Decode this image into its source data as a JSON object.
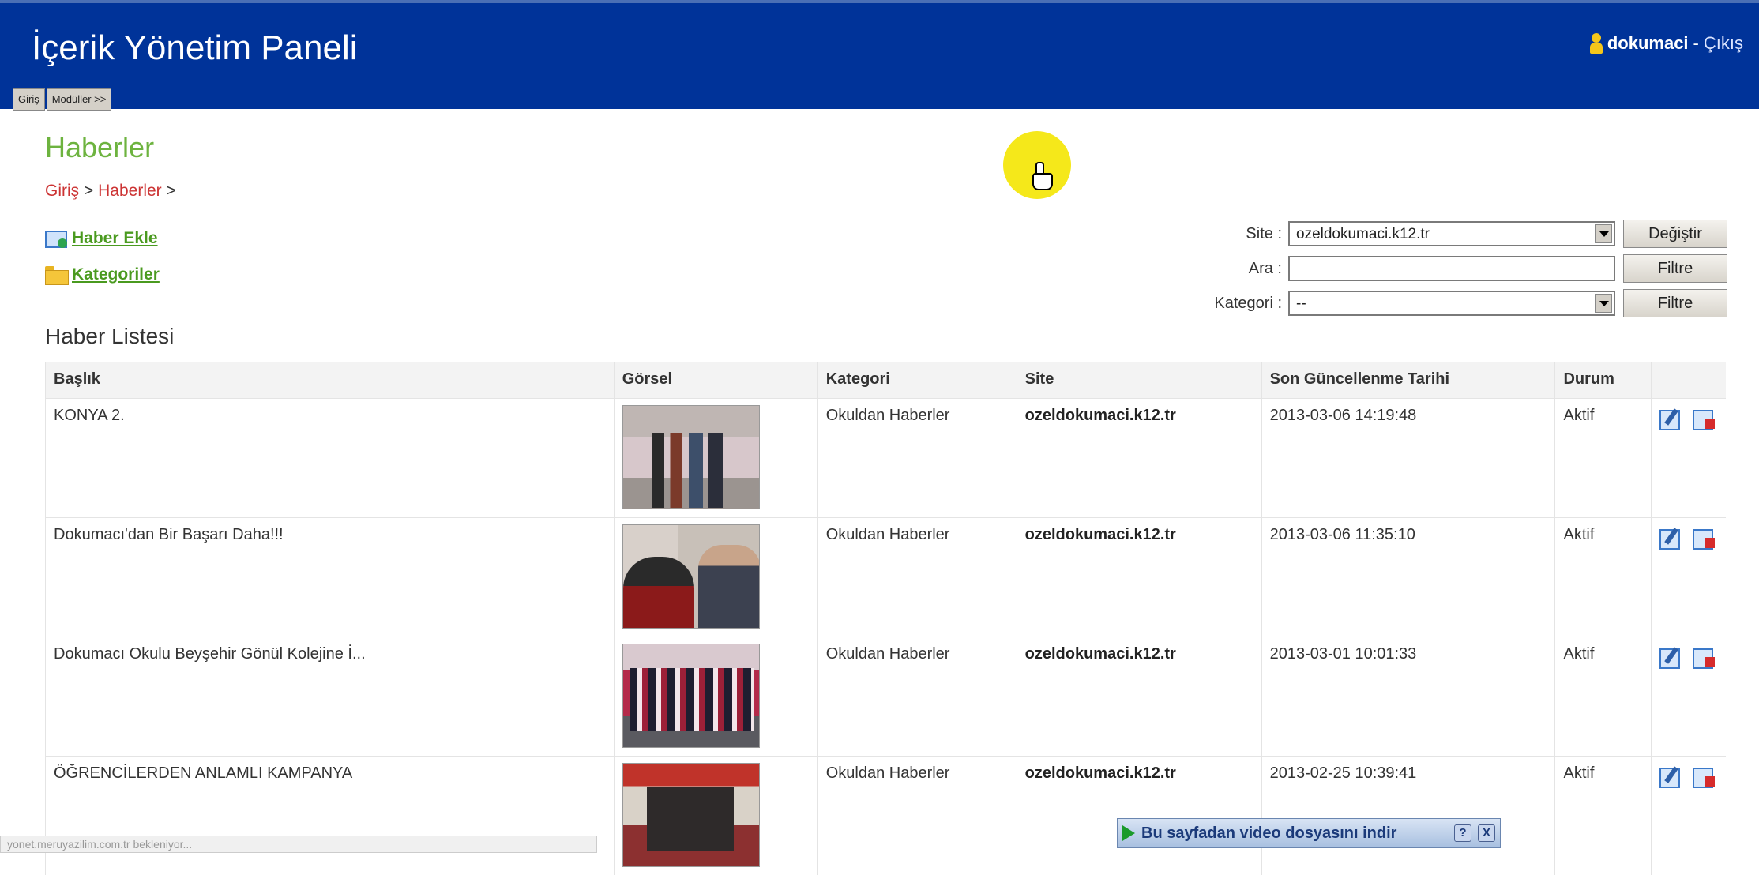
{
  "header": {
    "title": "İçerik Yönetim Paneli",
    "user": "dokumaci",
    "separator": " - ",
    "logout": "Çıkış",
    "menu": [
      "Giriş",
      "Modüller >>"
    ]
  },
  "page": {
    "title": "Haberler",
    "breadcrumb": [
      "Giriş",
      "Haberler"
    ],
    "breadcrumb_sep": ">",
    "actions": {
      "add_news": "Haber Ekle",
      "categories": "Kategoriler"
    },
    "list_title": "Haber Listesi"
  },
  "filters": {
    "site_label": "Site :",
    "site_value": "ozeldokumaci.k12.tr",
    "change_button": "Değiştir",
    "search_label": "Ara :",
    "search_value": "",
    "filter_button": "Filtre",
    "category_label": "Kategori :",
    "category_value": "--"
  },
  "table": {
    "columns": [
      "Başlık",
      "Görsel",
      "Kategori",
      "Site",
      "Son Güncellenme Tarihi",
      "Durum",
      ""
    ],
    "rows": [
      {
        "title": "KONYA 2.",
        "category": "Okuldan Haberler",
        "site": "ozeldokumaci.k12.tr",
        "updated": "2013-03-06 14:19:48",
        "status": "Aktif"
      },
      {
        "title": "Dokumacı'dan Bir Başarı Daha!!!",
        "category": "Okuldan Haberler",
        "site": "ozeldokumaci.k12.tr",
        "updated": "2013-03-06 11:35:10",
        "status": "Aktif"
      },
      {
        "title": "Dokumacı Okulu Beyşehir Gönül Kolejine İ...",
        "category": "Okuldan Haberler",
        "site": "ozeldokumaci.k12.tr",
        "updated": "2013-03-01 10:01:33",
        "status": "Aktif"
      },
      {
        "title": "ÖĞRENCİLERDEN ANLAMLI KAMPANYA",
        "category": "Okuldan Haberler",
        "site": "ozeldokumaci.k12.tr",
        "updated": "2013-02-25 10:39:41",
        "status": "Aktif"
      }
    ]
  },
  "status_bar": "yonet.meruyazilim.com.tr bekleniyor...",
  "video_bar": {
    "text": "Bu sayfadan video dosyasını indir",
    "help": "?",
    "close": "X"
  },
  "icons": {
    "user": "user-icon",
    "add": "add-news-icon",
    "folder": "folder-icon",
    "edit": "edit-icon",
    "delete": "delete-icon",
    "play": "play-icon"
  },
  "colors": {
    "header_bg": "#003399",
    "title_green": "#6db33f",
    "breadcrumb_red": "#cc3333",
    "cursor_highlight": "#f5e81a"
  }
}
